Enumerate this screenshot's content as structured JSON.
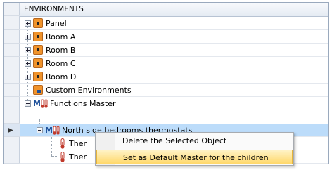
{
  "tree": {
    "header": "ENVIRONMENTS",
    "rows": [
      {
        "label": "Panel"
      },
      {
        "label": "Room A"
      },
      {
        "label": "Room B"
      },
      {
        "label": "Room C"
      },
      {
        "label": "Room D"
      },
      {
        "label": "Custom Environments"
      },
      {
        "label": "Functions Master"
      },
      {
        "label": "North side bedrooms thermostats"
      },
      {
        "label": "Ther"
      },
      {
        "label": "Ther"
      }
    ]
  },
  "context_menu": {
    "items": [
      {
        "label": "Delete the Selected Object"
      },
      {
        "label": "Set as Default Master for the children"
      }
    ]
  },
  "colors": {
    "selection": "#bcdcfa",
    "menu_highlight": "#ffd86b",
    "env_icon": "#f0932b"
  }
}
